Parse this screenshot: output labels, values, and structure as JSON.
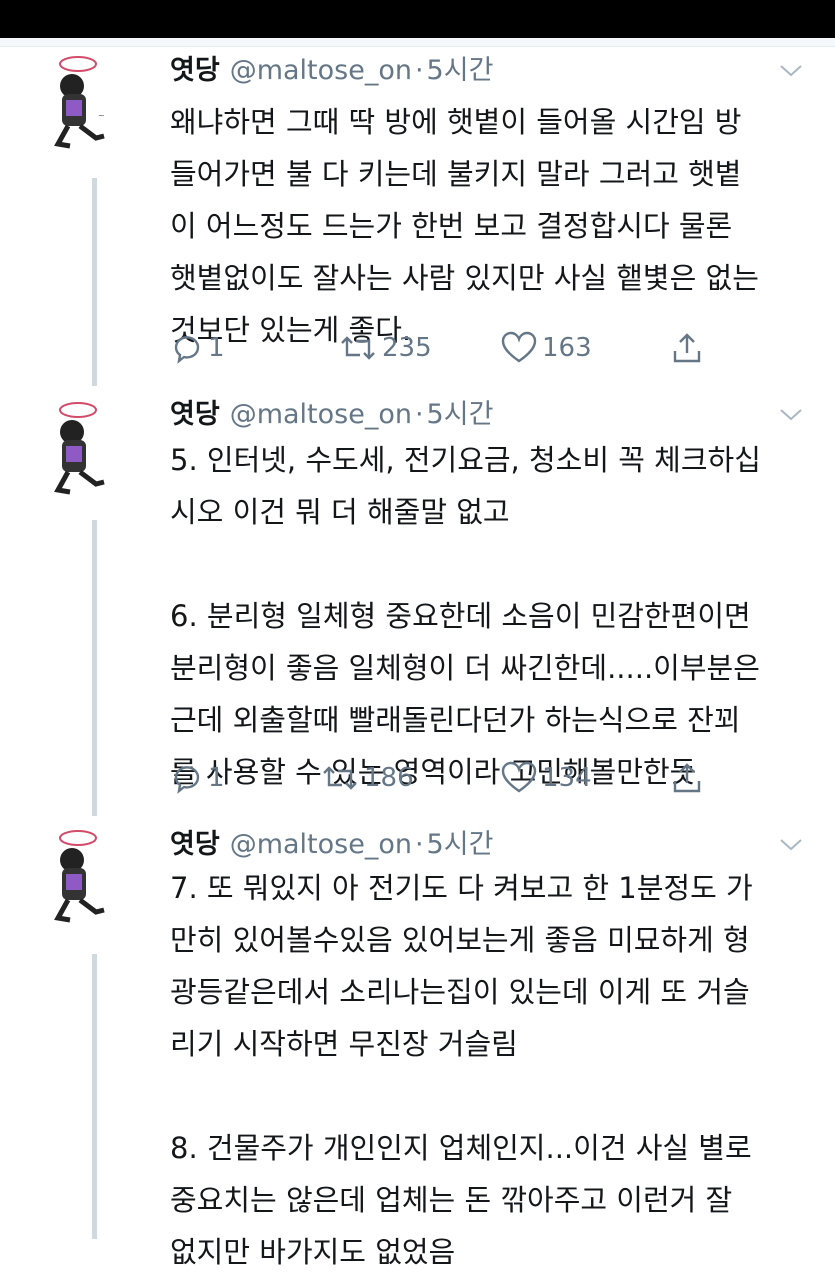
{
  "tweets": [
    {
      "name": "엿당",
      "handle": "@maltose_on",
      "dot": "·",
      "time": "5시간",
      "lines": [
        "왜냐하면 그때 딱 방에 햇볕이 들어올 시간임 방",
        "들어가면 불 다 키는데 불키지 말라 그러고 햇볕",
        "이 어느정도 드는가 한번 보고 결정합시다 물론",
        "햇볕없이도 잘사는 사람 있지만 사실 햍볓은 없는",
        "것보단 있는게 좋다."
      ],
      "replies": "1",
      "retweets": "235",
      "likes": "163"
    },
    {
      "name": "엿당",
      "handle": "@maltose_on",
      "dot": "·",
      "time": "5시간",
      "lines": [
        "5. 인터넷, 수도세, 전기요금, 청소비 꼭 체크하십",
        "시오 이건 뭐 더 해줄말 없고",
        "",
        "6. 분리형 일체형 중요한데 소음이 민감한편이면",
        "분리형이 좋음 일체형이 더 싸긴한데.....이부분은",
        "근데 외출할때 빨래돌린다던가 하는식으로 잔꾀",
        "를 사용할 수 있는 영역이라 고민해볼만한듯"
      ],
      "replies": "1",
      "retweets": "186",
      "likes": "134"
    },
    {
      "name": "엿당",
      "handle": "@maltose_on",
      "dot": "·",
      "time": "5시간",
      "lines": [
        "7. 또 뭐있지 아 전기도 다 켜보고 한 1분정도 가",
        "만히 있어볼수있음 있어보는게 좋음 미묘하게 형",
        "광등같은데서 소리나는집이 있는데 이게 또 거슬",
        "리기 시작하면 무진장 거슬림",
        "",
        "8. 건물주가 개인인지 업체인지...이건 사실 별로",
        "중요치는 않은데 업체는 돈 깎아주고 이런거 잘",
        "없지만 바가지도 없었음"
      ]
    }
  ],
  "colors": {
    "text": "#14171a",
    "secondary": "#657786",
    "thread_line": "#cfd9de",
    "avatar_accent": "#8e5bc4"
  }
}
